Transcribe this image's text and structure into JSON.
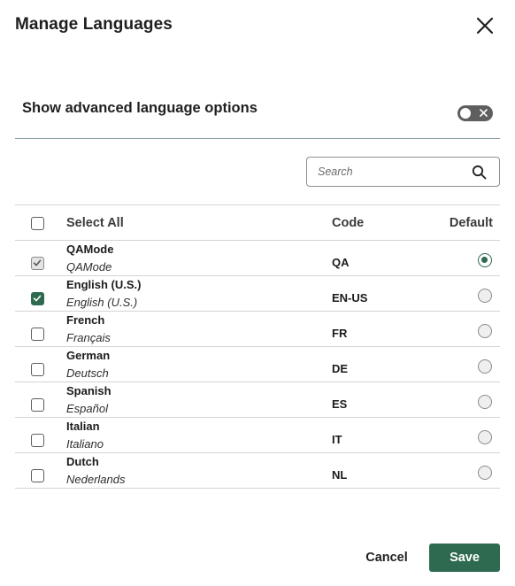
{
  "dialog": {
    "title": "Manage Languages",
    "close_icon": "close-icon"
  },
  "advanced": {
    "label": "Show advanced language options",
    "toggle_state": "off"
  },
  "search": {
    "placeholder": "Search",
    "value": ""
  },
  "table": {
    "headers": {
      "select_all": "Select All",
      "code": "Code",
      "default": "Default"
    },
    "rows": [
      {
        "name": "QAMode",
        "native": "QAMode",
        "code": "QA",
        "checked": "disabled-checked",
        "default": true
      },
      {
        "name": "English (U.S.)",
        "native": "English (U.S.)",
        "code": "EN-US",
        "checked": "checked",
        "default": false
      },
      {
        "name": "French",
        "native": "Français",
        "code": "FR",
        "checked": "unchecked",
        "default": false
      },
      {
        "name": "German",
        "native": "Deutsch",
        "code": "DE",
        "checked": "unchecked",
        "default": false
      },
      {
        "name": "Spanish",
        "native": "Español",
        "code": "ES",
        "checked": "unchecked",
        "default": false
      },
      {
        "name": "Italian",
        "native": "Italiano",
        "code": "IT",
        "checked": "unchecked",
        "default": false
      },
      {
        "name": "Dutch",
        "native": "Nederlands",
        "code": "NL",
        "checked": "unchecked",
        "default": false
      }
    ]
  },
  "footer": {
    "cancel_label": "Cancel",
    "save_label": "Save"
  },
  "colors": {
    "accent": "#2d6a4f",
    "toggle_off": "#5f5f5f",
    "divider": "#d4d4d4"
  }
}
